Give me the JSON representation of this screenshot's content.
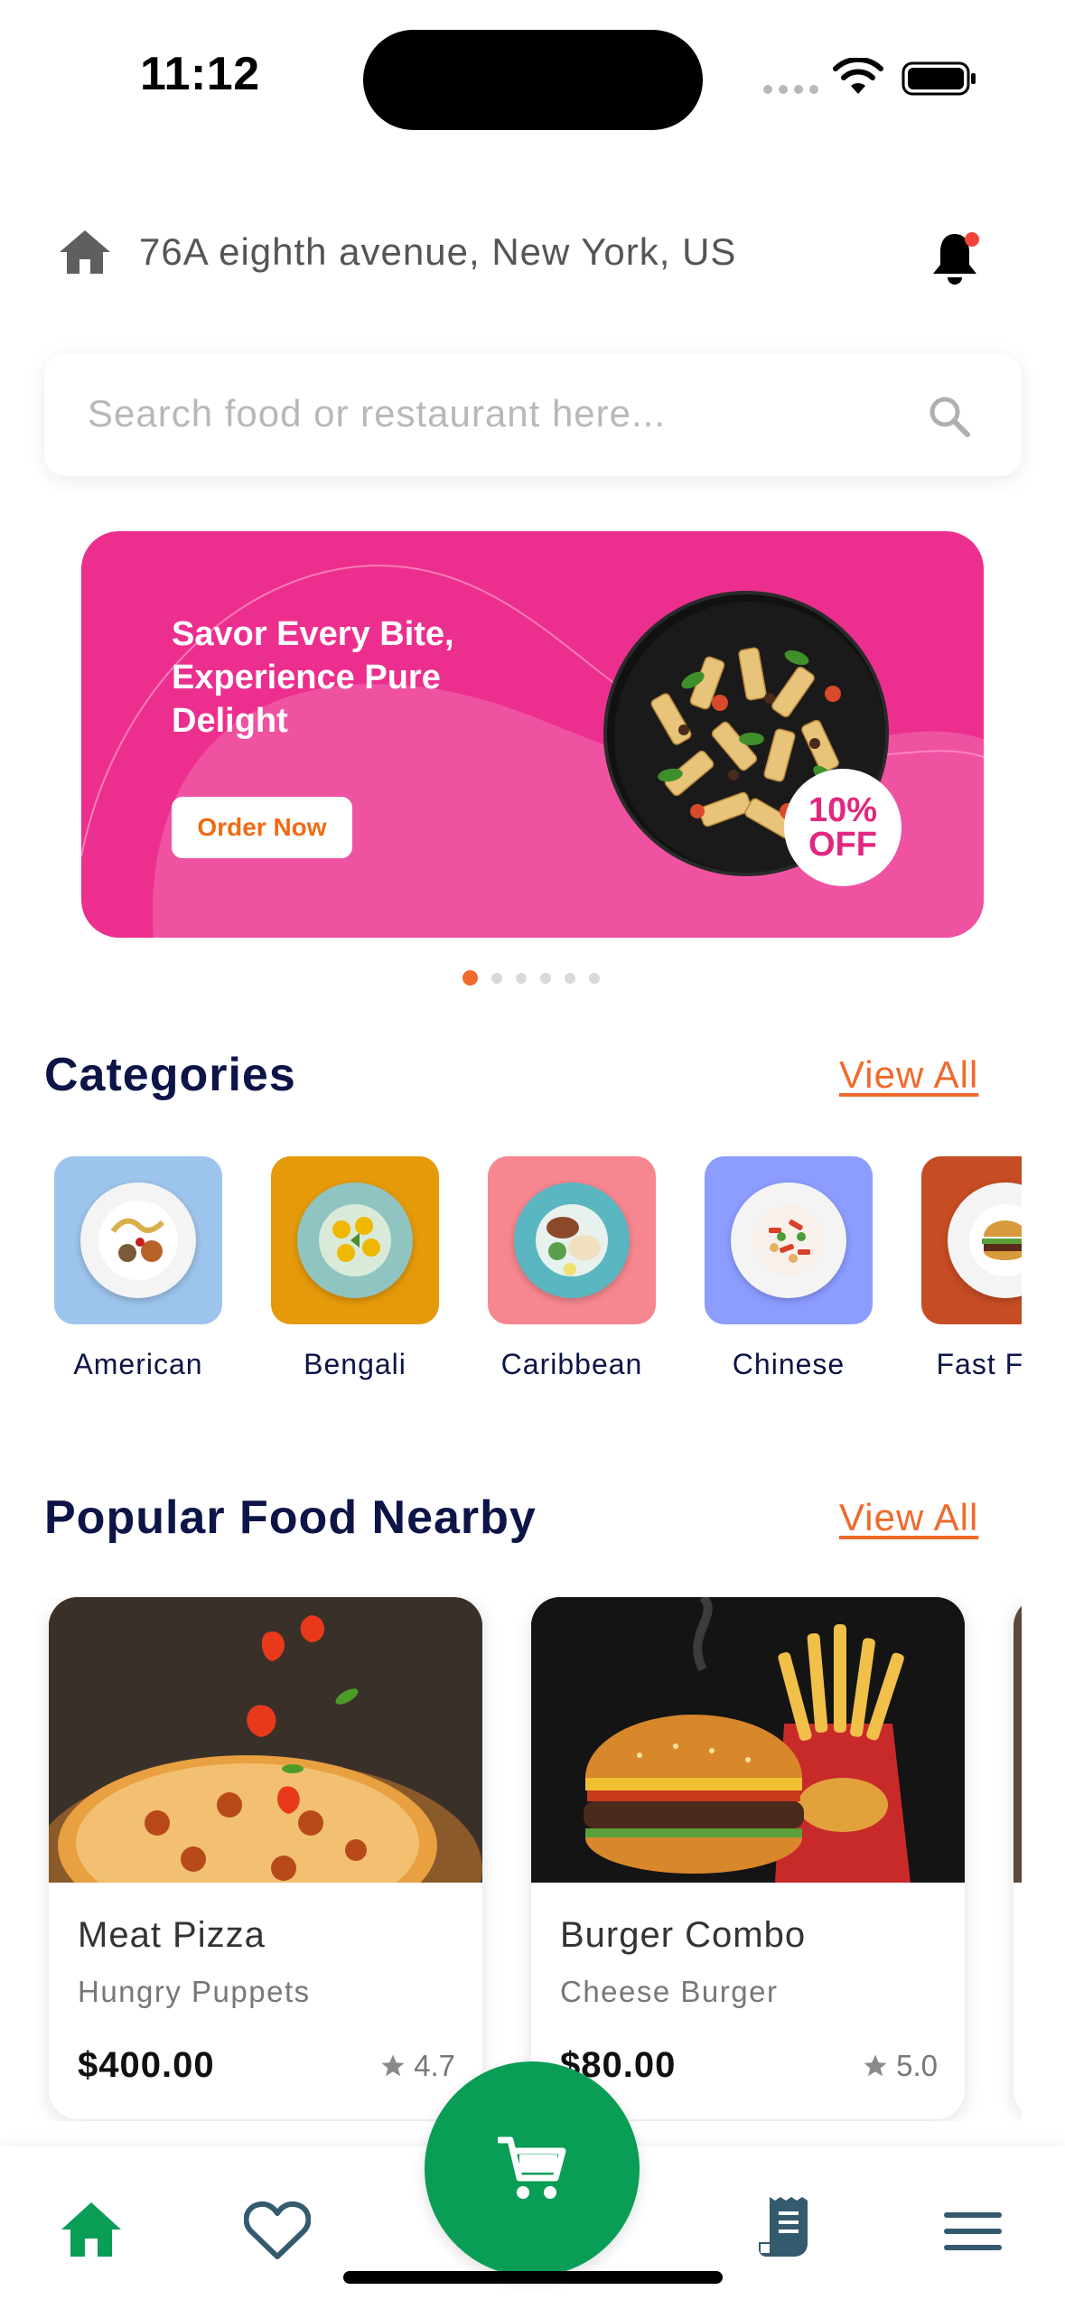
{
  "status_bar": {
    "time": "11:12"
  },
  "header": {
    "address": "76A eighth avenue, New York, US",
    "home_icon": "home-icon",
    "bell_icon": "bell-icon"
  },
  "search": {
    "placeholder": "Search food or restaurant here..."
  },
  "banner": {
    "title": "Savor Every Bite, Experience Pure Delight",
    "button_label": "Order Now",
    "discount_line1": "10%",
    "discount_line2": "OFF",
    "slides_total": 6,
    "active_slide": 1
  },
  "categories_section": {
    "title": "Categories",
    "view_all": "View All",
    "items": [
      {
        "label": "American",
        "color": "#9dc4ec"
      },
      {
        "label": "Bengali",
        "color": "#e59a0a"
      },
      {
        "label": "Caribbean",
        "color": "#f6868f"
      },
      {
        "label": "Chinese",
        "color": "#8c9cff"
      },
      {
        "label": "Fast Food",
        "color": "#c64c24"
      }
    ]
  },
  "popular_section": {
    "title": "Popular Food Nearby",
    "view_all": "View All",
    "items": [
      {
        "name": "Meat Pizza",
        "restaurant": "Hungry Puppets",
        "price": "$400.00",
        "rating": "4.7"
      },
      {
        "name": "Burger Combo",
        "restaurant": "Cheese Burger",
        "price": "$80.00",
        "rating": "5.0"
      }
    ]
  },
  "bottom_nav": {
    "items": [
      "home-icon",
      "heart-icon",
      "cart-icon",
      "receipt-icon",
      "menu-icon"
    ],
    "active": "home",
    "active_color": "#0a9d55",
    "inactive_color": "#345a6d"
  }
}
